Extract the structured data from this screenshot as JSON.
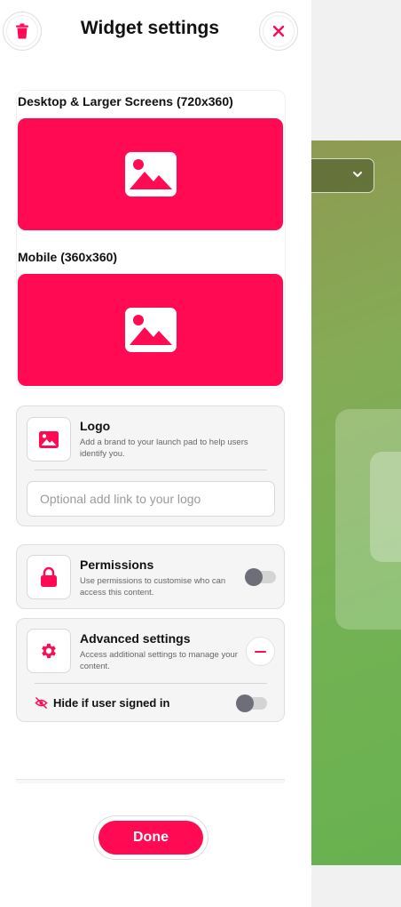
{
  "header": {
    "title": "Widget settings"
  },
  "images": {
    "desktop_label": "Desktop & Larger Screens (720x360)",
    "mobile_label": "Mobile (360x360)"
  },
  "logo": {
    "title": "Logo",
    "description": "Add a brand to your launch pad to help users identify you.",
    "link_value": "",
    "link_placeholder": "Optional add link to your logo"
  },
  "permissions": {
    "title": "Permissions",
    "description": "Use permissions to customise who can access this content.",
    "enabled": false
  },
  "advanced": {
    "title": "Advanced settings",
    "description": "Access additional settings to manage your content.",
    "hide_if_signed_in_label": "Hide if user signed in",
    "hide_if_signed_in": false
  },
  "footer": {
    "done_label": "Done"
  },
  "colors": {
    "accent": "#ff0a53",
    "toggle_knob": "#6d6e78"
  }
}
